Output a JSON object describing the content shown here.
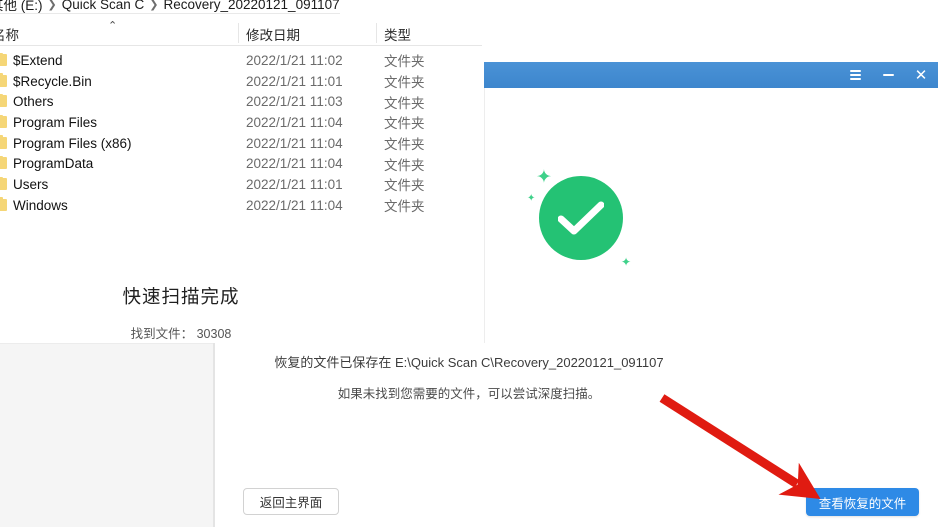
{
  "explorer": {
    "breadcrumb": {
      "items": [
        "其他 (E:)",
        "Quick Scan C",
        "Recovery_20220121_091107"
      ],
      "separator": "❯"
    },
    "columns": {
      "name": "名称",
      "date": "修改日期",
      "type": "类型",
      "sort_indicator": "⌃"
    },
    "rows": [
      {
        "name": "$Extend",
        "date": "2022/1/21 11:02",
        "type": "文件夹"
      },
      {
        "name": "$Recycle.Bin",
        "date": "2022/1/21 11:01",
        "type": "文件夹"
      },
      {
        "name": "Others",
        "date": "2022/1/21 11:03",
        "type": "文件夹"
      },
      {
        "name": "Program Files",
        "date": "2022/1/21 11:04",
        "type": "文件夹"
      },
      {
        "name": "Program Files (x86)",
        "date": "2022/1/21 11:04",
        "type": "文件夹"
      },
      {
        "name": "ProgramData",
        "date": "2022/1/21 11:04",
        "type": "文件夹"
      },
      {
        "name": "Users",
        "date": "2022/1/21 11:01",
        "type": "文件夹"
      },
      {
        "name": "Windows",
        "date": "2022/1/21 11:04",
        "type": "文件夹"
      }
    ]
  },
  "dialog": {
    "titlebar": {
      "menu_icon": "hamburger-menu-icon",
      "minimize_icon": "minimize-icon",
      "close_icon": "close-icon",
      "close_glyph": "✕",
      "background_color": "#3d86cd"
    },
    "status_icon": {
      "name": "success-check-icon",
      "color": "#24c274",
      "sparkle_glyph": "✦"
    },
    "title": "快速扫描完成",
    "found_files_label": "找到文件：",
    "found_files_count": "30308",
    "saved_path_text": "恢复的文件已保存在  E:\\Quick Scan C\\Recovery_20220121_091107",
    "hint_text": "如果未找到您需要的文件，可以尝试深度扫描。",
    "buttons": {
      "back_label": "返回主界面",
      "view_label": "查看恢复的文件",
      "view_color": "#2e8ae6"
    }
  },
  "annotation": {
    "arrow_name": "red-pointer-arrow",
    "color": "#e01b11"
  }
}
